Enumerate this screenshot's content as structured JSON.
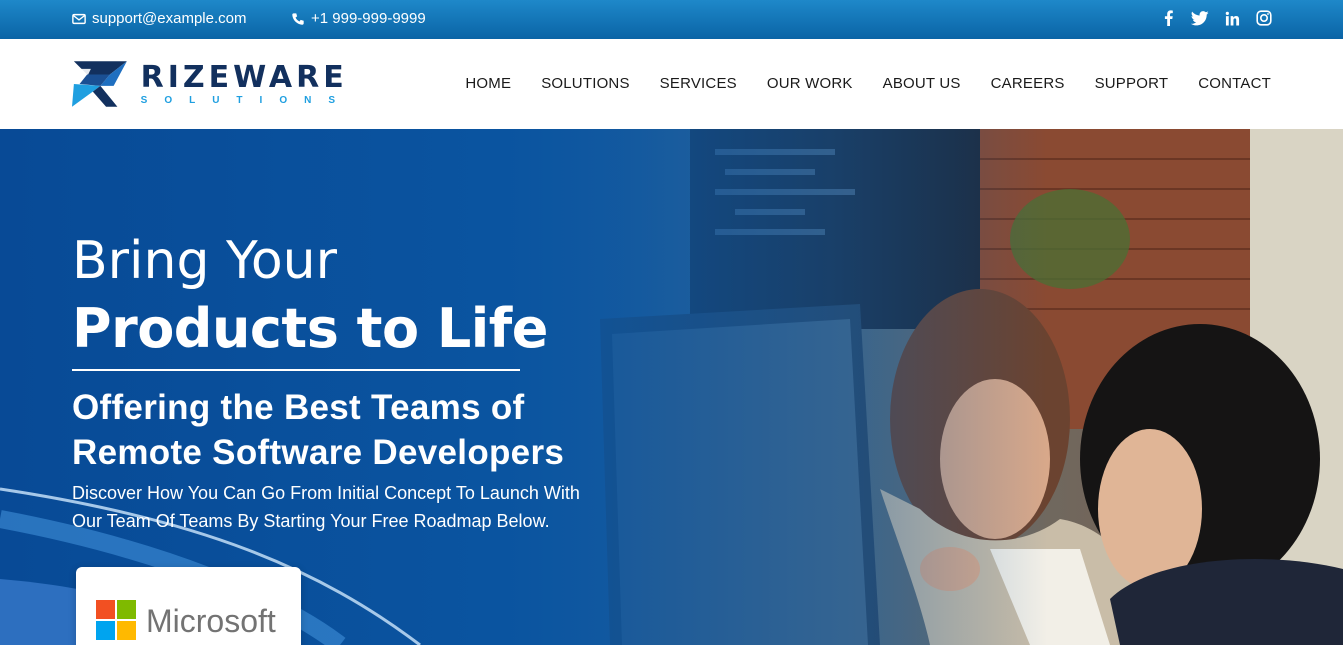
{
  "topbar": {
    "email": "support@example.com",
    "phone": "+1 999-999-9999",
    "socials": [
      "facebook-icon",
      "twitter-icon",
      "linkedin-icon",
      "instagram-icon"
    ]
  },
  "brand": {
    "name": "RIZEWARE",
    "tagline": "SOLUTIONS"
  },
  "nav": {
    "items": [
      "HOME",
      "SOLUTIONS",
      "SERVICES",
      "OUR WORK",
      "ABOUT US",
      "CAREERS",
      "SUPPORT",
      "CONTACT"
    ]
  },
  "hero": {
    "line1": "Bring Your",
    "line2": "Products to Life",
    "subtitle_line1": "Offering the Best Teams of",
    "subtitle_line2": "Remote Software Developers",
    "description": "Discover How You Can Go From Initial Concept To Launch With Our Team Of Teams By Starting Your Free Roadmap Below."
  },
  "partner": {
    "name": "Microsoft"
  },
  "colors": {
    "topbar": "#0a64a6",
    "brand_dark": "#12305e",
    "brand_accent": "#1f9fe0",
    "hero_blue": "#0a54a0"
  }
}
